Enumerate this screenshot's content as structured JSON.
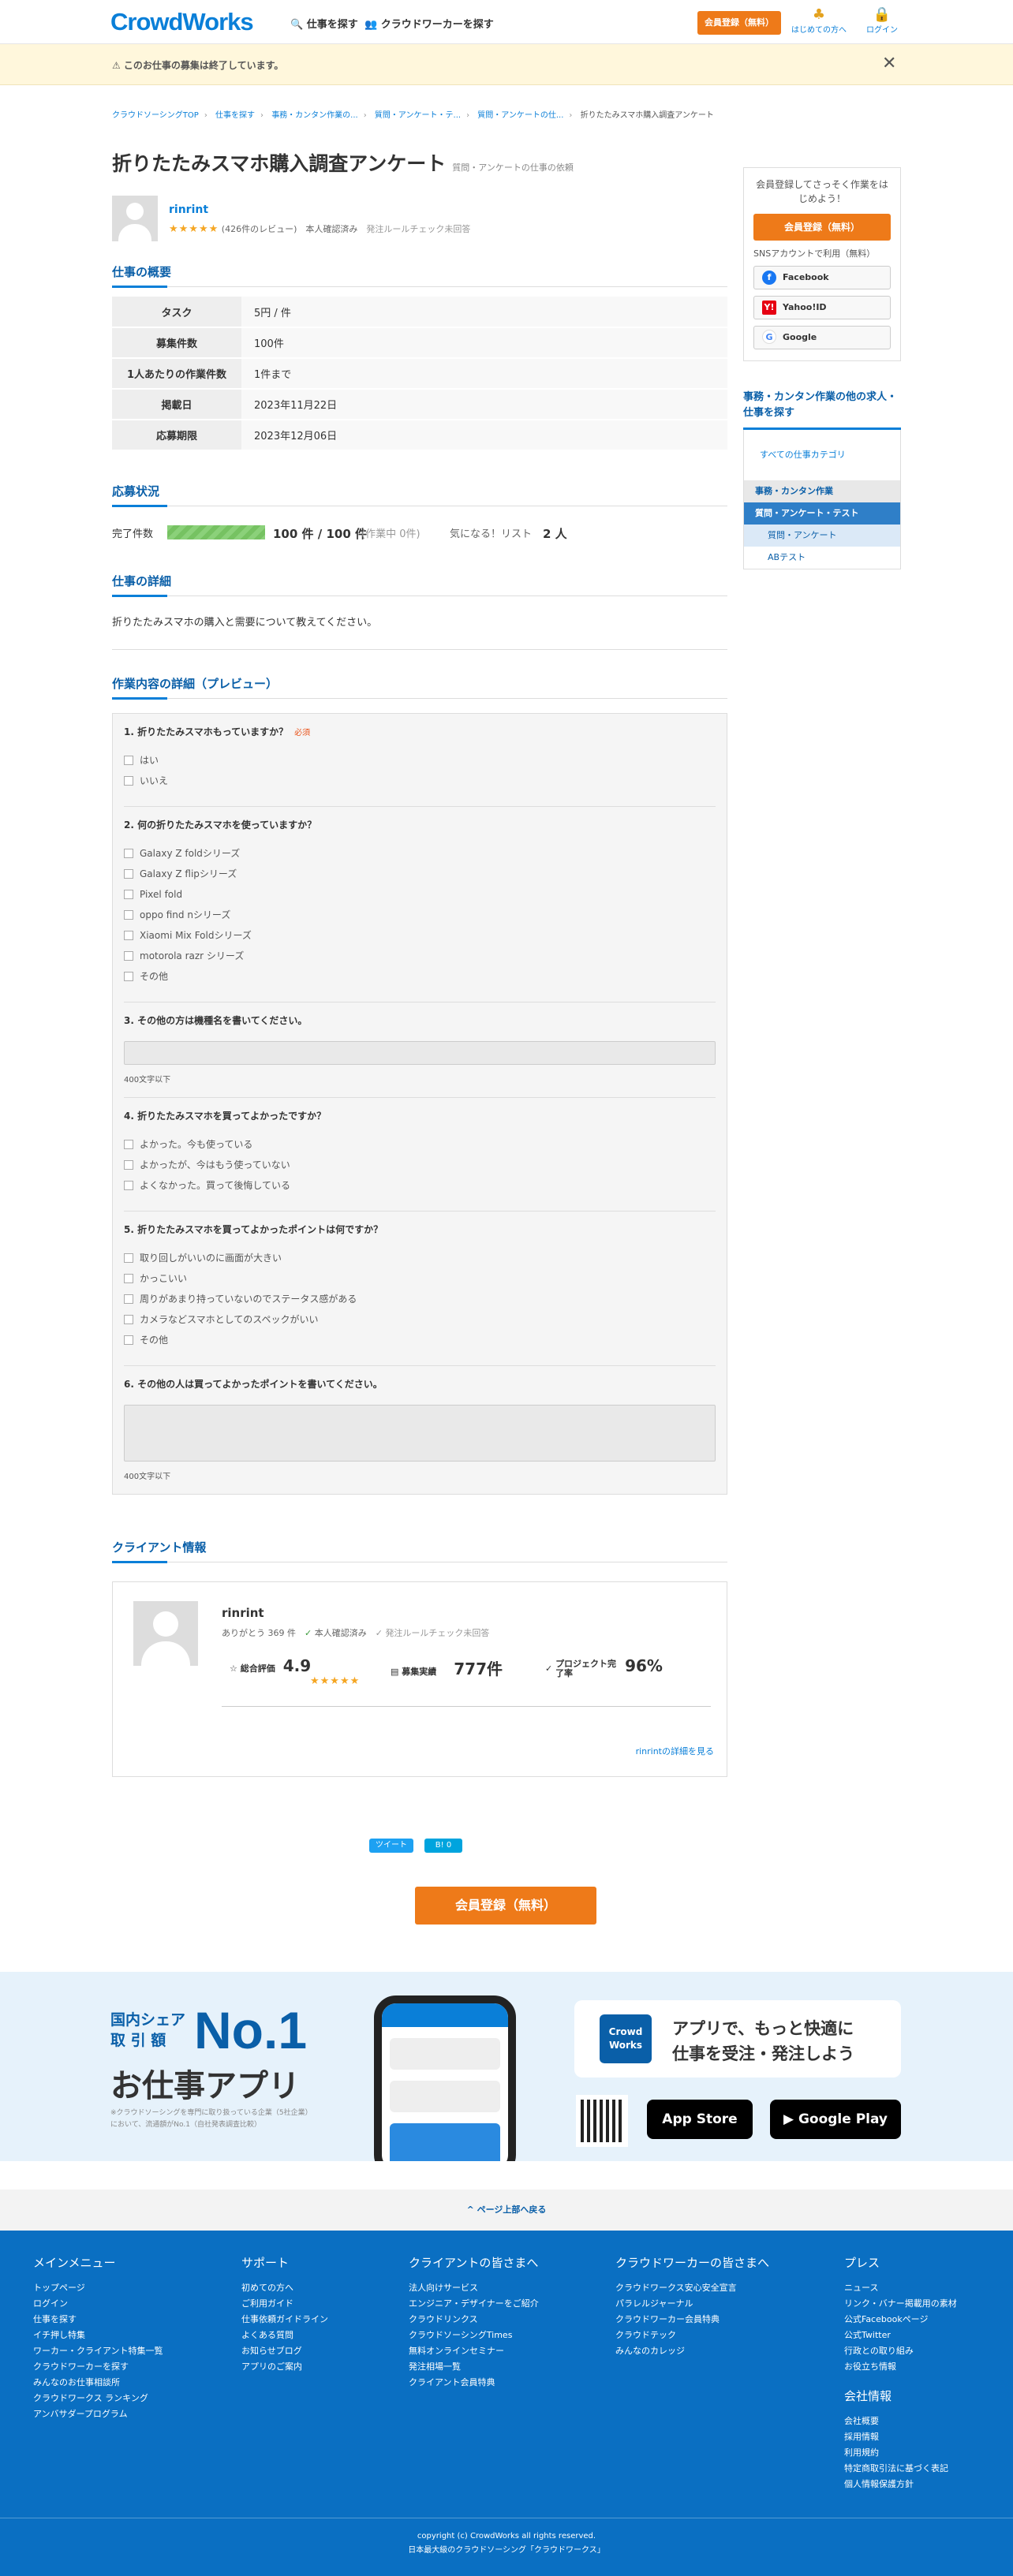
{
  "header": {
    "logo": "CrowdWorks",
    "find_jobs": "🔍 仕事を探す",
    "find_workers": "👥 クラウドワーカーを探す",
    "register": "会員登録（無料）",
    "beginner": "はじめての方へ",
    "login": "ログイン"
  },
  "notice": {
    "text": "⚠ このお仕事の募集は終了しています。",
    "close": "✕"
  },
  "breadcrumb": [
    "クラウドソーシングTOP",
    "仕事を探す",
    "事務・カンタン作業の...",
    "質問・アンケート・テ...",
    "質問・アンケートの仕...",
    "折りたたみスマホ購入調査アンケート"
  ],
  "job": {
    "title": "折りたたみスマホ購入調査アンケート",
    "category_note": "質問・アンケートの仕事の依頼",
    "user": "rinrint",
    "stars": "★★★★★",
    "reviews": "(426件のレビュー)",
    "verified": "本人確認済み",
    "rule": "発注ルールチェック未回答"
  },
  "overview": {
    "heading": "仕事の概要",
    "rows": [
      {
        "k": "タスク",
        "v": "5円 / 件"
      },
      {
        "k": "募集件数",
        "v": "100件"
      },
      {
        "k": "1人あたりの作業件数",
        "v": "1件まで"
      },
      {
        "k": "掲載日",
        "v": "2023年11月22日"
      },
      {
        "k": "応募期限",
        "v": "2023年12月06日"
      }
    ]
  },
  "status": {
    "heading": "応募状況",
    "label": "完了件数",
    "count": "100 件 / 100 件",
    "working": "(作業中 0件)",
    "fav_label": "気になる！リスト",
    "fav": "2 人",
    "progress": 1.0
  },
  "detail": {
    "heading": "仕事の詳細",
    "text": "折りたたみスマホの購入と需要について教えてください。"
  },
  "preview": {
    "heading": "作業内容の詳細（プレビュー）",
    "required": "必須",
    "limit": "400文字以下",
    "q1": {
      "t": "1. 折りたたみスマホもっていますか？",
      "o": [
        "はい",
        "いいえ"
      ]
    },
    "q2": {
      "t": "2. 何の折りたたみスマホを使っていますか？",
      "o": [
        "Galaxy Z foldシリーズ",
        "Galaxy Z flipシリーズ",
        "Pixel fold",
        "oppo find nシリーズ",
        "Xiaomi Mix Foldシリーズ",
        "motorola razr シリーズ",
        "その他"
      ]
    },
    "q3": {
      "t": "3. その他の方は機種名を書いてください。"
    },
    "q4": {
      "t": "4. 折りたたみスマホを買ってよかったですか？",
      "o": [
        "よかった。今も使っている",
        "よかったが、今はもう使っていない",
        "よくなかった。買って後悔している"
      ]
    },
    "q5": {
      "t": "5. 折りたたみスマホを買ってよかったポイントは何ですか？",
      "o": [
        "取り回しがいいのに画面が大きい",
        "かっこいい",
        "周りがあまり持っていないのでステータス感がある",
        "カメラなどスマホとしてのスペックがいい",
        "その他"
      ]
    },
    "q6": {
      "t": "6. その他の人は買ってよかったポイントを書いてください。"
    }
  },
  "client": {
    "heading": "クライアント情報",
    "name": "rinrint",
    "thanks": "ありがとう 369 件",
    "verified": "本人確認済み",
    "rule": "発注ルールチェック未回答",
    "rating_label": "総合評価",
    "rating": "4.9",
    "stars": "★★★★★",
    "orders_label": "募集実績",
    "orders": "777件",
    "rate_label": "プロジェクト完了率",
    "rate": "96%",
    "more": "rinrintの詳細を見る"
  },
  "share": {
    "tweet": "ツイート",
    "hatena": "B! 0"
  },
  "register_big": "会員登録（無料）",
  "side": {
    "prompt": "会員登録してさっそく作業をはじめよう！",
    "register": "会員登録（無料）",
    "sns": "SNSアカウントで利用（無料）",
    "facebook": "Facebook",
    "yahoo": "Yahoo!ID",
    "google": "Google",
    "other_title": "事務・カンタン作業の他の求人・仕事を探す",
    "all": "すべての仕事カテゴリ",
    "cat1": "事務・カンタン作業",
    "cat2": "質問・アンケート・テスト",
    "cat3": "質問・アンケート",
    "cat4": "ABテスト"
  },
  "hero": {
    "l1a": "国内シェア",
    "l1b": "取 引 額",
    "no1": "No.1",
    "l2": "お仕事アプリ",
    "note": "※クラウドソーシングを専門に取り扱っている企業（5社企業）において、流通額がNo.1（自社発表調査比較）",
    "logo": "Crowd Works",
    "msg1": "アプリで、もっと快適に",
    "msg2": "仕事を受注・発注しよう",
    "appstore": " App Store",
    "gplay": "▶ Google Play"
  },
  "totop": "^ ページ上部へ戻る",
  "footer": {
    "c1h": "メインメニュー",
    "c1": [
      "トップページ",
      "ログイン",
      "仕事を探す",
      "イチ押し特集",
      "ワーカー・クライアント特集一覧",
      "クラウドワーカーを探す",
      "みんなのお仕事相談所",
      "クラウドワークス ランキング",
      "アンバサダープログラム"
    ],
    "c2h": "サポート",
    "c2": [
      "初めての方へ",
      "ご利用ガイド",
      "仕事依頼ガイドライン",
      "よくある質問",
      "お知らせブログ",
      "アプリのご案内"
    ],
    "c3h": "クライアントの皆さまへ",
    "c3": [
      "法人向けサービス",
      "エンジニア・デザイナーをご紹介",
      "クラウドリンクス",
      "クラウドソーシングTimes",
      "無料オンラインセミナー",
      "発注相場一覧",
      "クライアント会員特典"
    ],
    "c4h": "クラウドワーカーの皆さまへ",
    "c4": [
      "クラウドワークス安心安全宣言",
      "パラレルジャーナル",
      "クラウドワーカー会員特典",
      "クラウドテック",
      "みんなのカレッジ"
    ],
    "c5h": "プレス",
    "c5": [
      "ニュース",
      "リンク・バナー掲載用の素材",
      "公式Facebookページ",
      "公式Twitter",
      "行政との取り組み",
      "お役立ち情報"
    ],
    "c6h": "会社情報",
    "c6": [
      "会社概要",
      "採用情報",
      "利用規約",
      "特定商取引法に基づく表記",
      "個人情報保護方針"
    ],
    "copy1": "copyright (c) CrowdWorks all rights reserved.",
    "copy2": "日本最大級のクラウドソーシング「クラウドワークス」"
  }
}
